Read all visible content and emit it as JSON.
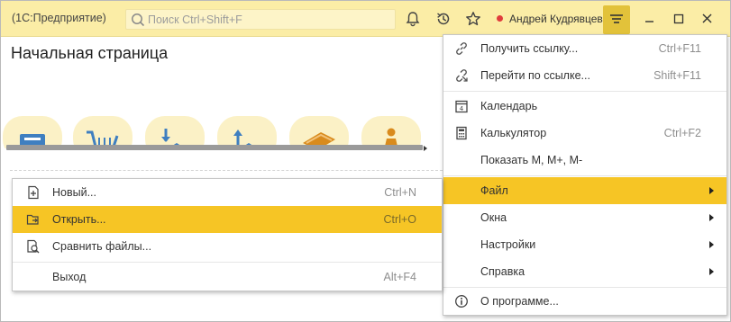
{
  "app": {
    "title": "(1С:Предприятие)",
    "search_placeholder": "Поиск Ctrl+Shift+F",
    "user_name": "Андрей Кудрявцев",
    "toolbar_icons": [
      "bell-icon",
      "history-icon",
      "star-icon"
    ],
    "window_controls": [
      "minimize-icon",
      "maximize-icon",
      "close-icon"
    ],
    "accent_color": "#f6c525"
  },
  "page": {
    "title": "Начальная страница",
    "tiles": [
      "document-tile-icon",
      "cart-tile-icon",
      "download-tile-icon",
      "upload-tile-icon",
      "money-tile-icon",
      "person-tile-icon"
    ]
  },
  "main_menu": {
    "items": [
      {
        "label": "Получить ссылку...",
        "shortcut": "Ctrl+F11",
        "icon": "link-icon"
      },
      {
        "label": "Перейти по ссылке...",
        "shortcut": "Shift+F11",
        "icon": "follow-link-icon"
      },
      {
        "label": "Календарь",
        "shortcut": "",
        "icon": "calendar-icon"
      },
      {
        "label": "Калькулятор",
        "shortcut": "Ctrl+F2",
        "icon": "calculator-icon"
      },
      {
        "label": "Показать М, М+, М-",
        "shortcut": "",
        "icon": ""
      },
      {
        "label": "Файл",
        "shortcut": "",
        "icon": "",
        "submenu": true,
        "active": true
      },
      {
        "label": "Окна",
        "shortcut": "",
        "icon": "",
        "submenu": true
      },
      {
        "label": "Настройки",
        "shortcut": "",
        "icon": "",
        "submenu": true
      },
      {
        "label": "Справка",
        "shortcut": "",
        "icon": "",
        "submenu": true
      },
      {
        "label": "О программе...",
        "shortcut": "",
        "icon": "info-icon"
      }
    ]
  },
  "file_menu": {
    "items": [
      {
        "label": "Новый...",
        "shortcut": "Ctrl+N",
        "icon": "new-file-icon"
      },
      {
        "label": "Открыть...",
        "shortcut": "Ctrl+O",
        "icon": "open-folder-icon",
        "active": true
      },
      {
        "label": "Сравнить файлы...",
        "shortcut": "",
        "icon": "compare-files-icon"
      },
      {
        "label": "Выход",
        "shortcut": "Alt+F4",
        "icon": ""
      }
    ]
  }
}
